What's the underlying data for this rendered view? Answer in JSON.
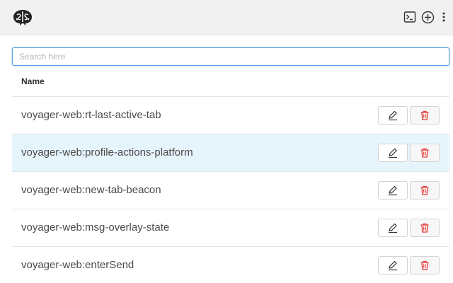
{
  "toolbar": {
    "logo_icon": "brain-logo-icon",
    "terminal_icon": "terminal-icon",
    "add_icon": "plus-circle-icon",
    "more_icon": "vertical-ellipsis-icon"
  },
  "search": {
    "placeholder": "Search here",
    "value": ""
  },
  "table": {
    "columns": [
      "Name"
    ],
    "rows": [
      {
        "name": "voyager-web:rt-last-active-tab",
        "highlighted": false
      },
      {
        "name": "voyager-web:profile-actions-platform",
        "highlighted": true
      },
      {
        "name": "voyager-web:new-tab-beacon",
        "highlighted": false
      },
      {
        "name": "voyager-web:msg-overlay-state",
        "highlighted": false
      },
      {
        "name": "voyager-web:enterSend",
        "highlighted": false
      }
    ]
  },
  "actions": {
    "edit_icon": "pencil-icon",
    "delete_icon": "trash-icon"
  },
  "colors": {
    "topbar_bg": "#f1f1f1",
    "highlight_row": "#e6f4fc",
    "delete_accent": "#e53935",
    "search_focus": "#5ea4e0"
  }
}
